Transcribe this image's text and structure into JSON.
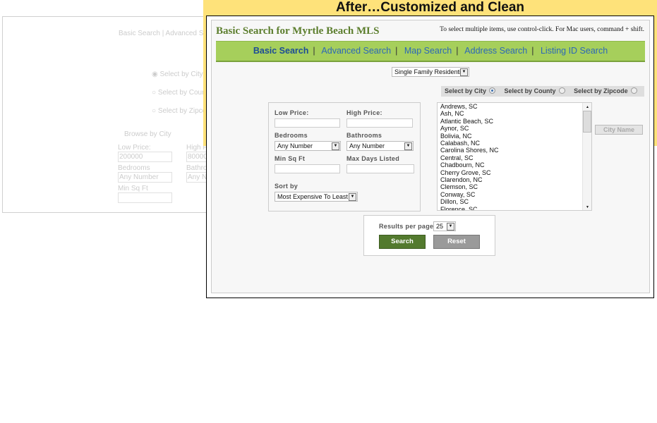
{
  "before": {
    "nav": "Basic Search  |  Advanced S",
    "radios": [
      "Select by City",
      "Select by Coun",
      "Select by Zipco"
    ],
    "browse": "Browse by City",
    "low_price_label": "Low Price:",
    "low_price": "200000",
    "high_price_label": "High P",
    "high_price": "80000",
    "bedrooms_label": "Bedrooms",
    "bedrooms": "Any Number",
    "bathrooms_label": "Bathro",
    "bathrooms": "Any N",
    "min_sqft_label": "Min Sq Ft"
  },
  "banner": "After…Customized and Clean",
  "title": "Basic Search for Myrtle Beach MLS",
  "hint": "To select multiple items, use control-click. For Mac users, command + shift.",
  "nav": [
    "Basic Search",
    "Advanced Search",
    "Map Search",
    "Address Search",
    "Listing ID Search"
  ],
  "property_type": "Single Family Residential",
  "radios": [
    {
      "label": "Select by City",
      "checked": true
    },
    {
      "label": "Select by County",
      "checked": false
    },
    {
      "label": "Select by Zipcode",
      "checked": false
    }
  ],
  "form": {
    "low_price": "Low Price:",
    "high_price": "High Price:",
    "bedrooms": "Bedrooms",
    "bedrooms_value": "Any Number",
    "bathrooms": "Bathrooms",
    "bathrooms_value": "Any Number",
    "min_sqft": "Min Sq Ft",
    "max_days": "Max Days Listed",
    "sort_by": "Sort by",
    "sort_value": "Most Expensive To Least"
  },
  "cities": [
    "Andrews, SC",
    "Ash, NC",
    "Atlantic Beach, SC",
    "Aynor, SC",
    "Bolivia, NC",
    "Calabash, NC",
    "Carolina Shores, NC",
    "Central, SC",
    "Chadbourn, NC",
    "Cherry Grove, SC",
    "Clarendon, NC",
    "Clemson, SC",
    "Conway, SC",
    "Dillon, SC",
    "Florence, SC"
  ],
  "city_name_button": "City Name",
  "results": {
    "label": "Results per page",
    "value": "25",
    "search": "Search",
    "reset": "Reset"
  },
  "colors": {
    "accent_green": "#a6cf5b",
    "title_green": "#5b7d2c",
    "search_button": "#537a2e",
    "banner_yellow": "#fee27a"
  }
}
